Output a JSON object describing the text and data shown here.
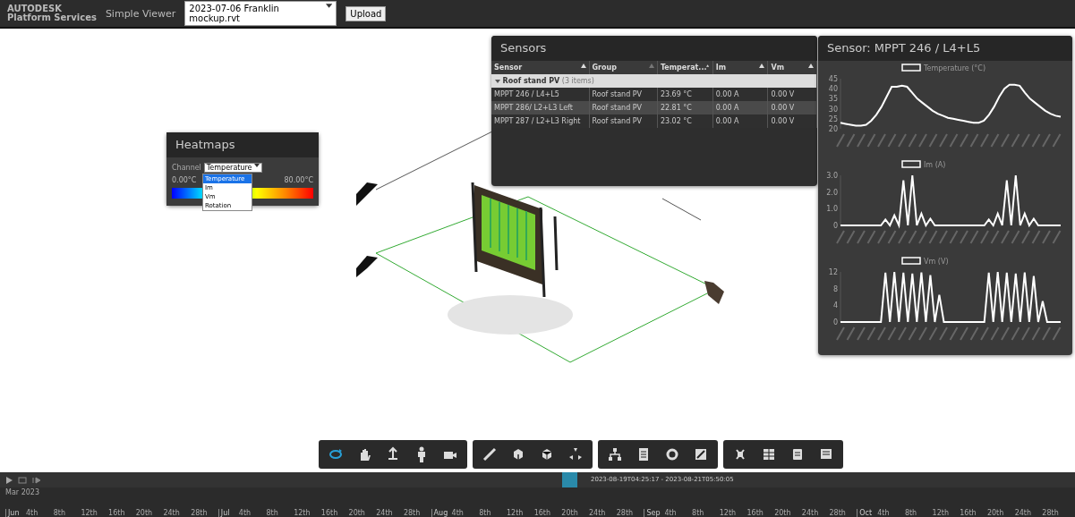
{
  "header": {
    "logo_top": "AUTODESK",
    "logo_bottom": "Platform Services",
    "app_name": "Simple Viewer",
    "model_select": "2023-07-06 Franklin mockup.rvt",
    "upload_button": "Upload"
  },
  "heatmaps": {
    "title": "Heatmaps",
    "channel_label": "Channel",
    "channel_value": "Temperature",
    "dropdown_open": true,
    "options": [
      {
        "label": "Temperature",
        "selected": true
      },
      {
        "label": "Im",
        "selected": false
      },
      {
        "label": "Vm",
        "selected": false
      },
      {
        "label": "Rotation",
        "selected": false
      }
    ],
    "scale_min": "0.00°C",
    "scale_max": "80.00°C"
  },
  "sensors": {
    "title": "Sensors",
    "columns": [
      {
        "label": "Sensor",
        "sorted": true
      },
      {
        "label": "Group",
        "sorted": false
      },
      {
        "label": "Temperat...",
        "sorted": true
      },
      {
        "label": "Im",
        "sorted": true
      },
      {
        "label": "Vm",
        "sorted": true
      }
    ],
    "groups": [
      {
        "label": "Roof stand PV",
        "count": "(3 items)",
        "expanded": true,
        "rows": [
          [
            "MPPT 246 / L4+L5",
            "Roof stand PV",
            "23.69 °C",
            "0.00 A",
            "0.00 V"
          ],
          [
            "MPPT 286/ L2+L3 Left",
            "Roof stand PV",
            "22.81 °C",
            "0.00 A",
            "0.00 V"
          ],
          [
            "MPPT 287 / L2+L3 Right",
            "Roof stand PV",
            "23.02 °C",
            "0.00 A",
            "0.00 V"
          ]
        ]
      }
    ]
  },
  "sensor_detail": {
    "title": "Sensor: MPPT 246 / L4+L5",
    "charts": [
      {
        "chart_data": {
          "type": "line",
          "ylim": [
            20,
            45
          ],
          "yticks": [
            20,
            25,
            30,
            35,
            40,
            45
          ],
          "series": [
            {
              "name": "Temperature (°C)",
              "color": "#ffffff",
              "values": [
                23,
                22.5,
                22,
                21.5,
                21.5,
                22,
                24,
                27,
                31,
                36,
                41,
                41,
                41.5,
                41,
                38,
                35,
                33,
                31,
                29,
                27.5,
                26.5,
                25.5,
                25,
                24.5,
                24,
                23.5,
                23,
                23,
                24,
                27,
                31,
                36,
                40,
                42,
                42,
                41.5,
                38,
                35,
                33,
                31,
                29,
                27.5,
                26.5,
                26
              ]
            }
          ]
        }
      },
      {
        "chart_data": {
          "type": "line",
          "ylim": [
            0,
            3
          ],
          "yticks": [
            {
              "value": 0,
              "label": "0"
            },
            {
              "value": 1,
              "label": "1.0"
            },
            {
              "value": 2,
              "label": "2.0"
            },
            {
              "value": 3,
              "label": "3.0"
            }
          ],
          "series": [
            {
              "name": "Im (A)",
              "color": "#ffffff",
              "values": [
                0,
                0,
                0,
                0,
                0,
                0,
                0,
                0,
                0,
                0,
                0.35,
                0,
                0.6,
                0,
                2.7,
                0,
                3.0,
                0,
                0.7,
                0,
                0.4,
                0,
                0,
                0,
                0,
                0,
                0,
                0,
                0,
                0,
                0,
                0,
                0,
                0.35,
                0,
                0.7,
                0,
                2.7,
                0,
                3.0,
                0,
                0.7,
                0,
                0.4,
                0,
                0,
                0,
                0,
                0,
                0
              ]
            }
          ]
        }
      },
      {
        "chart_data": {
          "type": "line",
          "ylim": [
            0,
            12
          ],
          "yticks": [
            0,
            4,
            8,
            12
          ],
          "series": [
            {
              "name": "Vm (V)",
              "color": "#ffffff",
              "values": [
                0,
                0,
                0,
                0,
                0,
                0,
                0,
                0,
                0,
                0,
                11.8,
                0,
                12,
                0,
                11.8,
                0,
                11.6,
                0,
                11.9,
                0,
                11.2,
                0,
                6.5,
                0,
                0,
                0,
                0,
                0,
                0,
                0,
                0,
                0,
                0,
                11.8,
                0,
                12,
                0,
                11.8,
                0,
                11.6,
                0,
                11.9,
                0,
                11,
                0,
                5,
                0,
                0,
                0,
                0
              ]
            }
          ]
        }
      }
    ]
  },
  "toolbar": {
    "groups": [
      [
        {
          "kind": "orbit",
          "selected": true
        },
        {
          "kind": "pan",
          "selected": false
        },
        {
          "kind": "zoom",
          "selected": false
        },
        {
          "kind": "walk",
          "selected": false
        },
        {
          "kind": "camera",
          "selected": false
        }
      ],
      [
        {
          "kind": "measure",
          "selected": false
        },
        {
          "kind": "section",
          "selected": false
        },
        {
          "kind": "cube",
          "selected": false
        },
        {
          "kind": "explode",
          "selected": false
        }
      ],
      [
        {
          "kind": "tree",
          "selected": false
        },
        {
          "kind": "properties",
          "selected": false
        },
        {
          "kind": "settings",
          "selected": false
        },
        {
          "kind": "fullscreen",
          "selected": false
        }
      ],
      [
        {
          "kind": "bug",
          "selected": false
        },
        {
          "kind": "grid",
          "selected": false
        },
        {
          "kind": "list",
          "selected": false
        },
        {
          "kind": "panel",
          "selected": false
        }
      ]
    ]
  },
  "timeline": {
    "range": "2023-08-19T04:25:17 - 2023-08-21T05:50:05",
    "year": "Mar 2023",
    "months": [
      {
        "label": "Jun",
        "days": [
          "4th",
          "8th",
          "12th",
          "16th",
          "20th",
          "24th",
          "28th"
        ]
      },
      {
        "label": "Jul",
        "days": [
          "4th",
          "8th",
          "12th",
          "16th",
          "20th",
          "24th",
          "28th"
        ]
      },
      {
        "label": "Aug",
        "days": [
          "4th",
          "8th",
          "12th",
          "16th",
          "20th",
          "24th",
          "28th"
        ]
      },
      {
        "label": "Sep",
        "days": [
          "4th",
          "8th",
          "12th",
          "16th",
          "20th",
          "24th",
          "28th"
        ]
      },
      {
        "label": "Oct",
        "days": [
          "4th",
          "8th",
          "12th",
          "16th",
          "20th",
          "24th",
          "28th"
        ]
      }
    ]
  }
}
